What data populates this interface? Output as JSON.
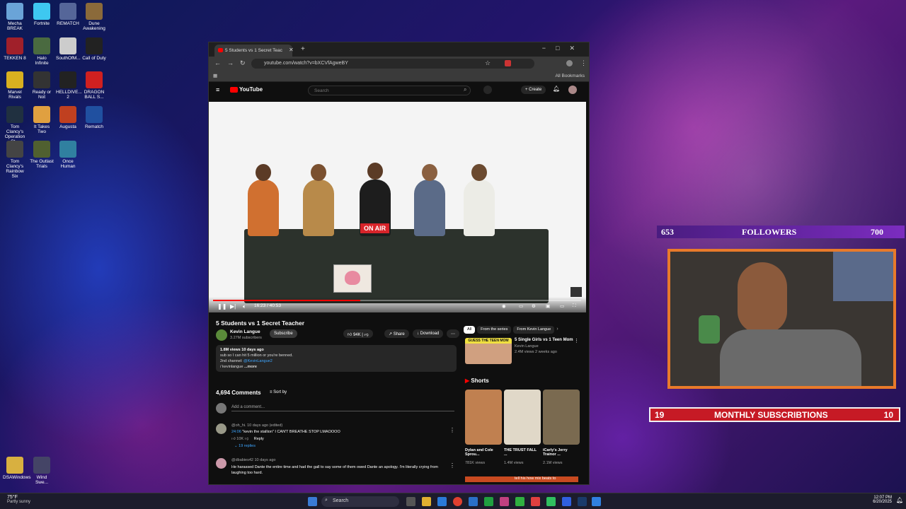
{
  "desktop": {
    "icons": [
      {
        "label": "Mecha BREAK",
        "color": "#6aa4d8"
      },
      {
        "label": "Fortnite",
        "color": "#3ec8f0"
      },
      {
        "label": "REMATCH",
        "color": "#556699"
      },
      {
        "label": "Dune Awakening",
        "color": "#8b6a3a"
      },
      {
        "label": "TEKKEN 8",
        "color": "#a0202a"
      },
      {
        "label": "Halo Infinite",
        "color": "#4a6a40"
      },
      {
        "label": "SouthOfM...",
        "color": "#ccc"
      },
      {
        "label": "Call of Duty",
        "color": "#222"
      },
      {
        "label": "Marvel Rivals",
        "color": "#d8b020"
      },
      {
        "label": "Ready or Not",
        "color": "#333"
      },
      {
        "label": "HELLDIVE... 2",
        "color": "#222"
      },
      {
        "label": "DRAGON BALL S...",
        "color": "#d02020"
      },
      {
        "label": "Tom Clancy's Operation St...",
        "color": "#203040"
      },
      {
        "label": "It Takes Two",
        "color": "#e0a040"
      },
      {
        "label": "Augusta",
        "color": "#c04020"
      },
      {
        "label": "Rematch",
        "color": "#2050a0"
      },
      {
        "label": "Tom Clancy's Rainbow Six",
        "color": "#444"
      },
      {
        "label": "The Outlast Trials",
        "color": "#506030"
      },
      {
        "label": "Once Human",
        "color": "#3080a0"
      },
      {
        "label": "DSAWindows",
        "color": "#d8b040"
      },
      {
        "label": "Wind Swe...",
        "color": "#446"
      }
    ]
  },
  "browser": {
    "tab_title": "5 Students vs 1 Secret Teac",
    "url": "youtube.com/watch?v=bXCVfAgweBY",
    "bookmarks": "All Bookmarks"
  },
  "youtube": {
    "logo": "YouTube",
    "search_placeholder": "Search",
    "create": "Create",
    "on_air": "ON AIR",
    "time": "16:23 / 40:53",
    "video_title": "5 Students vs 1 Secret Teacher",
    "channel": "Kevin Langue",
    "subscribers": "3.27M subscribers",
    "subscribe": "Subscribe",
    "likes": "94K",
    "share": "Share",
    "download": "Download",
    "desc_meta": "1.8M views  10 days ago",
    "desc_line1": "sub so I can hit 5 million or you're benned.",
    "desc_line2_label": "2nd channel:",
    "desc_line2_link": "@KevinLangue2",
    "desc_line3": "/ kevinlangue",
    "desc_more": "...more",
    "comments_count": "4,694 Comments",
    "sort_by": "Sort by",
    "add_comment": "Add a comment...",
    "comment1_meta": "@oh_hi.  10 days ago (edited)",
    "comment1_ts": "24:06",
    "comment1_text": " \"kevin the stallion\" I CAN'T BREATHE STOP LMAOOOO",
    "comment1_likes": "10K",
    "reply": "Reply",
    "comment1_replies": "19 replies",
    "comment2_meta": "@dbabies42  10 days ago",
    "comment2_text": "He harassed Dante the entire time and had the gall to say some of them owed Dante an apology. I'm literally crying from laughing too hard.",
    "chips": [
      "All",
      "From the series",
      "From Kevin Langue"
    ],
    "rec_thumb_text": "GUESS THE TEEN MOM",
    "rec_title": "5 Single Girls vs 1 Teen Mom",
    "rec_channel": "Kevin Langue",
    "rec_meta": "2.4M views  2 weeks ago",
    "shorts_title": "Shorts",
    "shorts": [
      {
        "title": "Dylan and Cole Sprou...",
        "views": "781K views",
        "color": "#c08050"
      },
      {
        "title": "THE TRUST FALL ...",
        "views": "1.4M views",
        "color": "#e0d8c8"
      },
      {
        "title": "iCarly's Jerry Trainor ...",
        "views": "2.1M views",
        "color": "#7a6a50"
      }
    ],
    "shorts_next": "tell his how mix  beats to"
  },
  "overlay": {
    "followers_left": "653",
    "followers_label": "FOLLOWERS",
    "followers_right": "700",
    "subs_left": "19",
    "subs_label": "MONTHLY SUBSCRIBTIONS",
    "subs_right": "10"
  },
  "taskbar": {
    "weather_temp": "75°F",
    "weather_desc": "Partly sunny",
    "search": "Search",
    "time": "12:07 PM",
    "date": "6/20/2025"
  }
}
